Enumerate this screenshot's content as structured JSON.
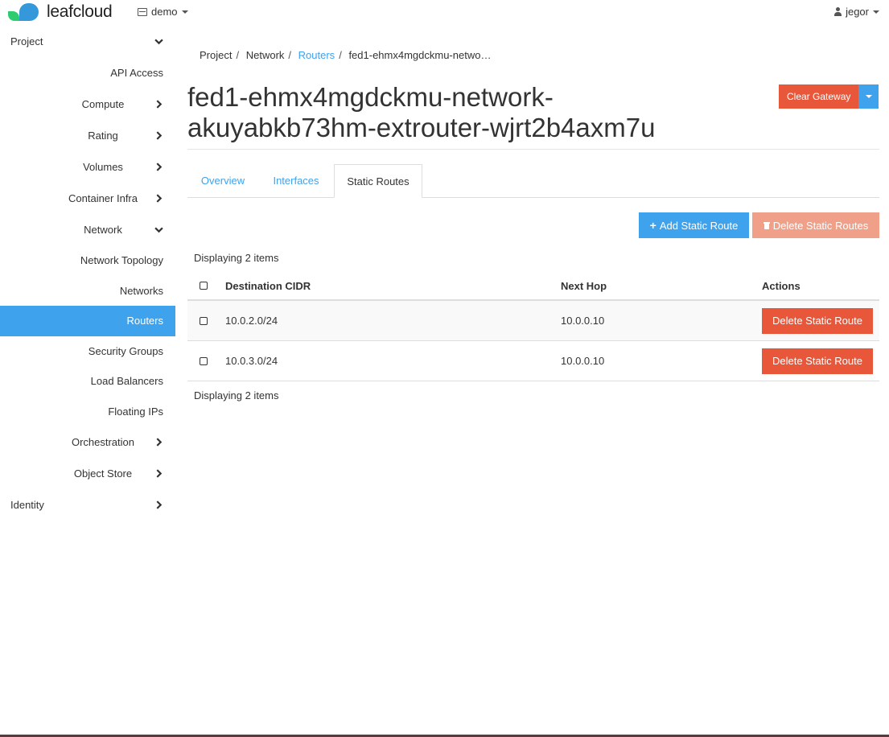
{
  "brand": {
    "name": "leafcloud"
  },
  "header": {
    "project": "demo",
    "user": "jegor"
  },
  "sidebar": {
    "project": "Project",
    "api_access": "API Access",
    "compute": "Compute",
    "rating": "Rating",
    "volumes": "Volumes",
    "container_infra": "Container Infra",
    "network": "Network",
    "network_topology": "Network Topology",
    "networks": "Networks",
    "routers": "Routers",
    "security_groups": "Security Groups",
    "load_balancers": "Load Balancers",
    "floating_ips": "Floating IPs",
    "orchestration": "Orchestration",
    "object_store": "Object Store",
    "identity": "Identity"
  },
  "breadcrumb": {
    "project": "Project",
    "network": "Network",
    "routers": "Routers",
    "current": "fed1-ehmx4mgdckmu-netwo…"
  },
  "page": {
    "title_line1": "fed1-ehmx4mgdckmu-network-",
    "title_line2": "akuyabkb73hm-extrouter-wjrt2b4axm7u",
    "clear_gateway": "Clear Gateway"
  },
  "tabs": {
    "overview": "Overview",
    "interfaces": "Interfaces",
    "static_routes": "Static Routes"
  },
  "actions": {
    "add": "Add Static Route",
    "delete_all": "Delete Static Routes"
  },
  "table": {
    "count_text": "Displaying 2 items",
    "headers": {
      "destination": "Destination CIDR",
      "next_hop": "Next Hop",
      "actions": "Actions"
    },
    "rows": [
      {
        "destination": "10.0.2.0/24",
        "next_hop": "10.0.0.10",
        "action": "Delete Static Route"
      },
      {
        "destination": "10.0.3.0/24",
        "next_hop": "10.0.0.10",
        "action": "Delete Static Route"
      }
    ]
  },
  "colors": {
    "accent": "#3fa2ed",
    "danger": "#e9573a",
    "danger_disabled": "#f0a089"
  }
}
